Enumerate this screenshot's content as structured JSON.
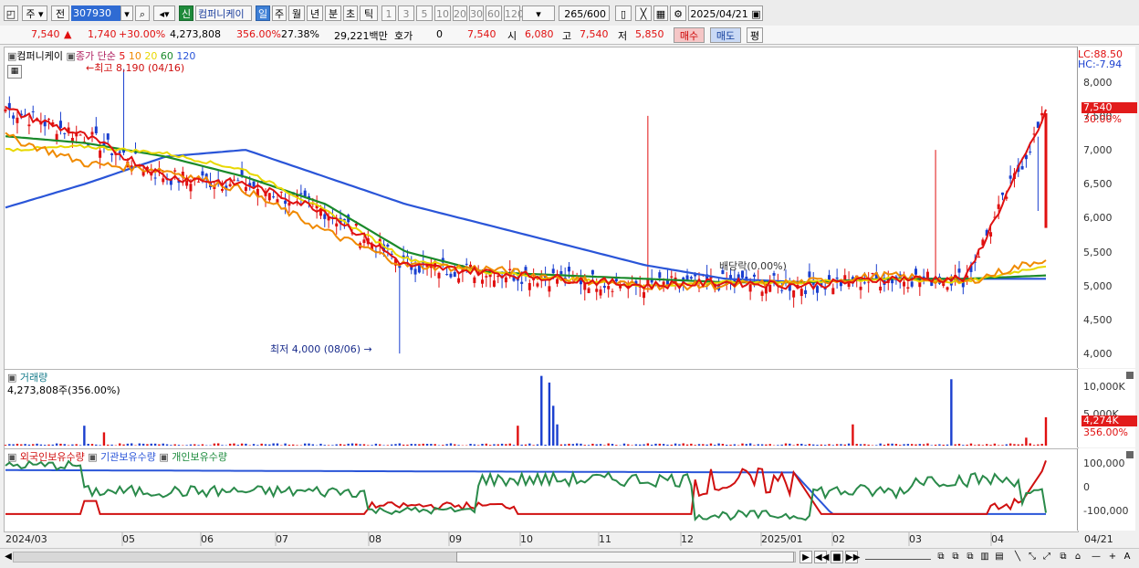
{
  "toolbar": {
    "market": "주",
    "prev_label": "전",
    "stock_code": "307930",
    "new_badge": "신",
    "stock_name": "컴퍼니케이",
    "periods": [
      "일",
      "주",
      "월",
      "년",
      "분",
      "초",
      "틱"
    ],
    "active_period": "일",
    "minutes": [
      "1",
      "3",
      "5",
      "10",
      "20",
      "30",
      "60",
      "120"
    ],
    "count_value": "265",
    "count_total": "/600",
    "date": "2025/04/21"
  },
  "quote": {
    "price": "7,540",
    "change": "1,740",
    "change_pct": "+30.00%",
    "volume": "4,273,808",
    "vol_ratio": "356.00%",
    "turnover": "27.38%",
    "amount": "29,221백만",
    "hoga_label": "호가",
    "hoga_value": "0",
    "hoga_price": "7,540",
    "open_label": "시",
    "open": "6,080",
    "high_label": "고",
    "high": "7,540",
    "low_label": "저",
    "low": "5,850",
    "buy_label": "매수",
    "sell_label": "매도",
    "avg_label": "평"
  },
  "price_panel": {
    "stock_name": "컴퍼니케이",
    "legend_label": "종가 단순",
    "ma": [
      "5",
      "10",
      "20",
      "60",
      "120"
    ],
    "ma_colors": [
      "#e01010",
      "#f08a00",
      "#e8d800",
      "#1a8a2a",
      "#2a55d8"
    ],
    "high_annotation": "최고 8,190 (04/16)",
    "low_annotation": "최저 4,000 (08/06)",
    "dividend_annotation": "배당락(0.00%)",
    "lc": "LC:88.50",
    "hc": "HC:-7.94",
    "last_price": "7,540",
    "last_pct": "30.00%",
    "y_ticks": [
      "8,000",
      "7,500",
      "7,000",
      "6,500",
      "6,000",
      "5,500",
      "5,000",
      "4,500",
      "4,000"
    ]
  },
  "volume_panel": {
    "title": "거래량",
    "value": "4,273,808주(356.00%)",
    "y_ticks": [
      "10,000K",
      "5,000K"
    ],
    "last_value": "4,274K",
    "last_pct": "356.00%"
  },
  "holding_panel": {
    "foreign": "외국인보유수량",
    "institution": "기관보유수량",
    "individual": "개인보유수량",
    "y_ticks": [
      "100,000",
      "0",
      "-100,000"
    ]
  },
  "x_axis": [
    "2024/03",
    "05",
    "06",
    "07",
    "08",
    "09",
    "10",
    "11",
    "12",
    "2025/01",
    "02",
    "03",
    "04"
  ],
  "x_axis_right": "04/21",
  "chart_data": {
    "type": "line",
    "title": "",
    "x": [
      "2024/03",
      "05",
      "06",
      "07",
      "08",
      "09",
      "10",
      "11",
      "12",
      "2025/01",
      "02",
      "03",
      "04",
      "04/21"
    ],
    "series": [
      {
        "values": [
          7600,
          7200,
          6600,
          6500,
          6100,
          5300,
          5200,
          5100,
          5000,
          5050,
          5000,
          5100,
          5100,
          7540
        ]
      },
      {
        "values": [
          7200,
          6800,
          6700,
          6400,
          5800,
          5300,
          5250,
          5100,
          5000,
          5000,
          5050,
          5150,
          5050,
          5400
        ]
      },
      {
        "values": [
          7000,
          7050,
          6950,
          6700,
          6100,
          5400,
          5200,
          5100,
          5000,
          5050,
          5050,
          5100,
          5050,
          5300
        ]
      },
      {
        "values": [
          7200,
          7100,
          6900,
          6600,
          6200,
          5500,
          5200,
          5150,
          5100,
          5050,
          5050,
          5100,
          5100,
          5150
        ]
      },
      {
        "values": [
          6150,
          6500,
          6900,
          7000,
          6600,
          6200,
          5900,
          5600,
          5300,
          5100,
          5050,
          5100,
          5100,
          5100
        ]
      }
    ],
    "ylim": [
      3800,
      8400
    ],
    "volume_ylim": [
      0,
      11000
    ],
    "high": {
      "date": "04/16",
      "value": 8190
    },
    "low": {
      "date": "08/06",
      "value": 4000
    }
  }
}
